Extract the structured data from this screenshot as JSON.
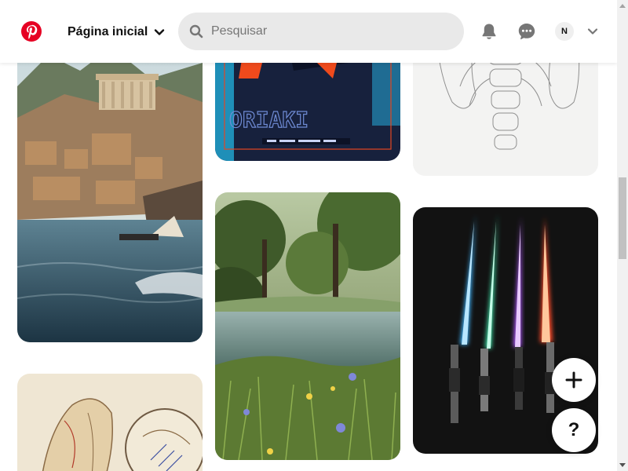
{
  "header": {
    "home_label": "Página inicial",
    "search_placeholder": "Pesquisar",
    "avatar_initial": "N"
  },
  "floating": {
    "help_label": "?"
  },
  "pins": [
    {
      "subject": "greek-city-harbor-painting"
    },
    {
      "subject": "anatomy-sketch"
    },
    {
      "subject": "poster-oriaki"
    },
    {
      "subject": "forest-stream-landscape"
    },
    {
      "subject": "ribcage-line-drawing"
    },
    {
      "subject": "glowing-crystal-sabers"
    }
  ],
  "colors": {
    "brand": "#e60023",
    "search_bg": "#e9e9e9",
    "text": "#111111",
    "icon": "#767676"
  }
}
